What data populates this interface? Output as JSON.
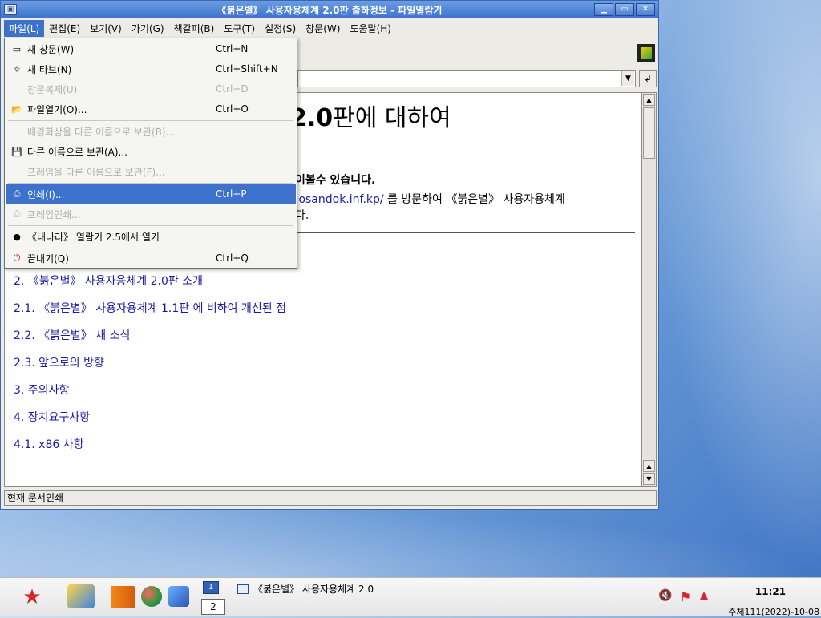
{
  "window": {
    "title": "《붉은별》 사용자용체계 2.0판 출하정보 - 파일열람기",
    "buttons": [
      "▁",
      "▭",
      "✕"
    ]
  },
  "menubar": [
    {
      "name": "menu-file",
      "label": "파일(L)"
    },
    {
      "name": "menu-edit",
      "label": "편집(E)"
    },
    {
      "name": "menu-view",
      "label": "보기(V)"
    },
    {
      "name": "menu-go",
      "label": "가기(G)"
    },
    {
      "name": "menu-bookmarks",
      "label": "책갈피(B)"
    },
    {
      "name": "menu-tools",
      "label": "도구(T)"
    },
    {
      "name": "menu-settings",
      "label": "설정(S)"
    },
    {
      "name": "menu-window",
      "label": "창문(W)"
    },
    {
      "name": "menu-help",
      "label": "도움말(H)"
    }
  ],
  "file_menu": {
    "items": [
      {
        "label": "새 창문(W)",
        "shortcut": "Ctrl+N",
        "icon": "new-window-icon",
        "state": "enabled"
      },
      {
        "label": "새 타브(N)",
        "shortcut": "Ctrl+Shift+N",
        "icon": "new-tab-icon",
        "state": "enabled"
      },
      {
        "label": "창문복제(U)",
        "shortcut": "Ctrl+D",
        "icon": "",
        "state": "disabled"
      },
      {
        "label": "파일열기(O)...",
        "shortcut": "Ctrl+O",
        "icon": "open-file-icon",
        "state": "enabled"
      },
      {
        "label": "배경화상을 다른 이름으로 보관(B)...",
        "shortcut": "",
        "icon": "",
        "state": "disabled"
      },
      {
        "label": "다른 이름으로 보관(A)...",
        "shortcut": "",
        "icon": "save-as-icon",
        "state": "enabled"
      },
      {
        "label": "프레임을 다른 이름으로 보관(F)...",
        "shortcut": "",
        "icon": "",
        "state": "disabled"
      },
      {
        "label": "인쇄(I)...",
        "shortcut": "Ctrl+P",
        "icon": "print-icon",
        "state": "highlighted"
      },
      {
        "label": "프레임인쇄...",
        "shortcut": "",
        "icon": "print-frame-icon",
        "state": "disabled"
      },
      {
        "label": "《내나라》 열람기 2.5에서 열기",
        "shortcut": "",
        "icon": "globe-icon",
        "state": "enabled"
      },
      {
        "label": "끝내기(Q)",
        "shortcut": "Ctrl+Q",
        "icon": "quit-icon",
        "state": "enabled"
      }
    ]
  },
  "document": {
    "heading_prefix": "2.0",
    "heading_rest": "판에 대하여",
    "line1": "이볼수 있습니다.",
    "line2_link": ".osandok.inf.kp/",
    "line2_rest": " 를 방문하여 《붉은별》 사용자용체계",
    "line3": "다.",
    "toc": [
      "2. 《붉은별》 사용자용체계 2.0판 소개",
      "2.1. 《붉은별》 사용자용체계 1.1판 에 비하여 개선된 점",
      "2.2. 《붉은별》 새 소식",
      "2.3. 앞으로의 방향",
      "3. 주의사항",
      "4. 장치요구사항",
      "4.1. x86 사항"
    ]
  },
  "status": "현재 문서인쇄",
  "taskbar": {
    "window_icon_label": "1",
    "pager": "2",
    "task_title": "《붉은별》 사용자용체계 2.0",
    "time": "11:21",
    "date": "주체111(2022)-10-08"
  },
  "colors": {
    "titlebar": "#3c72cc",
    "highlight": "#3c72cc",
    "link": "#1a1aa6",
    "brand_red": "#d8242c"
  }
}
